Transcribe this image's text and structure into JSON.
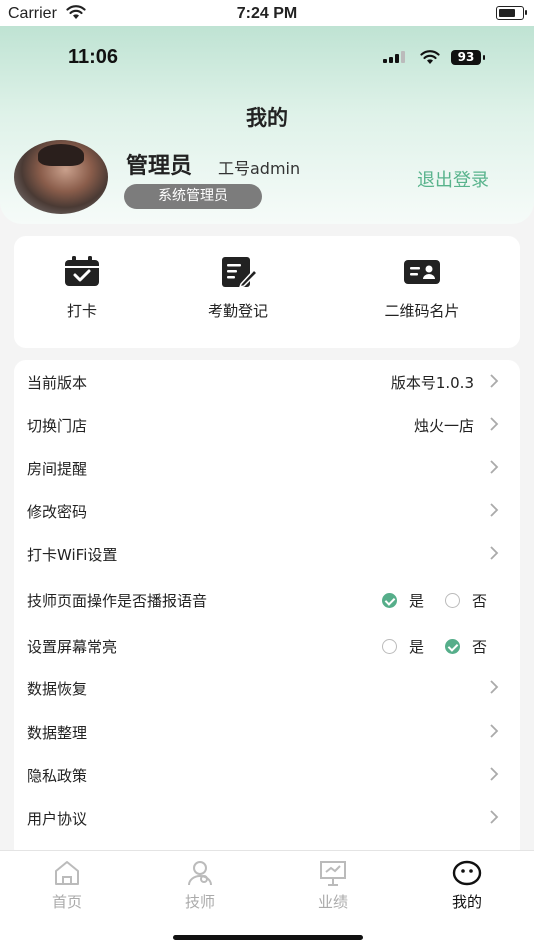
{
  "system_status": {
    "carrier": "Carrier",
    "time": "7:24 PM"
  },
  "app_status": {
    "time": "11:06",
    "battery": "93"
  },
  "header": {
    "title": "我的",
    "user_name": "管理员",
    "employee_id": "工号admin",
    "role": "系统管理员",
    "logout_label": "退出登录"
  },
  "quick_actions": [
    {
      "label": "打卡",
      "icon": "calendar-check-icon"
    },
    {
      "label": "考勤登记",
      "icon": "edit-register-icon"
    },
    {
      "label": "二维码名片",
      "icon": "id-card-icon"
    }
  ],
  "settings": {
    "version": {
      "label": "当前版本",
      "value": "版本号1.0.3"
    },
    "store": {
      "label": "切换门店",
      "value": "烛火一店"
    },
    "room_reminder": {
      "label": "房间提醒"
    },
    "change_password": {
      "label": "修改密码"
    },
    "wifi": {
      "label": "打卡WiFi设置"
    },
    "voice": {
      "label": "技师页面操作是否播报语音",
      "yes": "是",
      "no": "否",
      "selected": "是"
    },
    "screen": {
      "label": "设置屏幕常亮",
      "yes": "是",
      "no": "否",
      "selected": "否"
    },
    "restore": {
      "label": "数据恢复"
    },
    "organize": {
      "label": "数据整理"
    },
    "privacy": {
      "label": "隐私政策"
    },
    "agreement": {
      "label": "用户协议"
    }
  },
  "tabbar": [
    {
      "label": "首页",
      "icon": "home-icon",
      "active": false
    },
    {
      "label": "技师",
      "icon": "person-icon",
      "active": false
    },
    {
      "label": "业绩",
      "icon": "presentation-icon",
      "active": false
    },
    {
      "label": "我的",
      "icon": "smiley-icon",
      "active": true
    }
  ],
  "colors": {
    "accent": "#58b38c",
    "header_top": "#bfe3d3",
    "role_badge": "#7c7c7c"
  }
}
